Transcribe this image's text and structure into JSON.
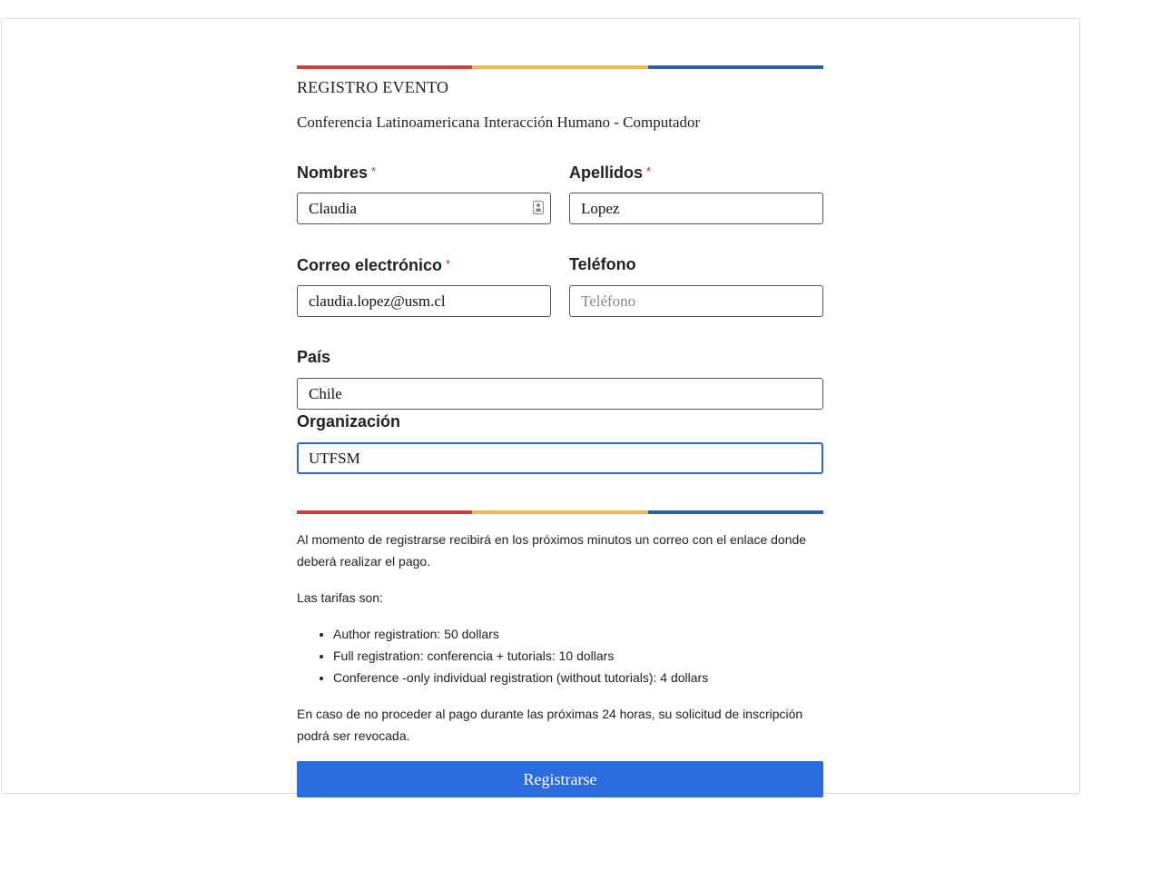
{
  "colors": {
    "red": "#d23b3b",
    "yellow": "#f2b84b",
    "blue": "#2e5f9e",
    "button": "#2a6bde",
    "focus": "#2b65c9"
  },
  "header": {
    "title": "REGISTRO EVENTO",
    "subtitle": "Conferencia Latinoamericana Interacción Humano - Computador"
  },
  "form": {
    "nombres": {
      "label": "Nombres",
      "required_mark": "*",
      "value": "Claudia",
      "icon": "contact-card-icon"
    },
    "apellidos": {
      "label": "Apellidos",
      "required_mark": "*",
      "value": "Lopez"
    },
    "correo": {
      "label": "Correo electrónico",
      "required_mark": "*",
      "value": "claudia.lopez@usm.cl"
    },
    "telefono": {
      "label": "Teléfono",
      "value": "",
      "placeholder": "Teléfono"
    },
    "pais": {
      "label": "País",
      "value": "Chile"
    },
    "organizacion": {
      "label": "Organización",
      "value": "UTFSM"
    }
  },
  "info": {
    "intro": "Al momento de registrarse recibirá en los próximos minutos un correo con el enlace donde deberá realizar el pago.",
    "fees_heading": "Las tarifas son:",
    "fees": [
      "Author registration: 50 dollars",
      "Full registration: conferencia + tutorials: 10 dollars",
      "Conference -only individual registration (without tutorials): 4 dollars"
    ],
    "warning": "En caso de no proceder al pago durante las próximas 24 horas, su solicitud de inscripción podrá ser revocada."
  },
  "submit_label": "Registrarse"
}
